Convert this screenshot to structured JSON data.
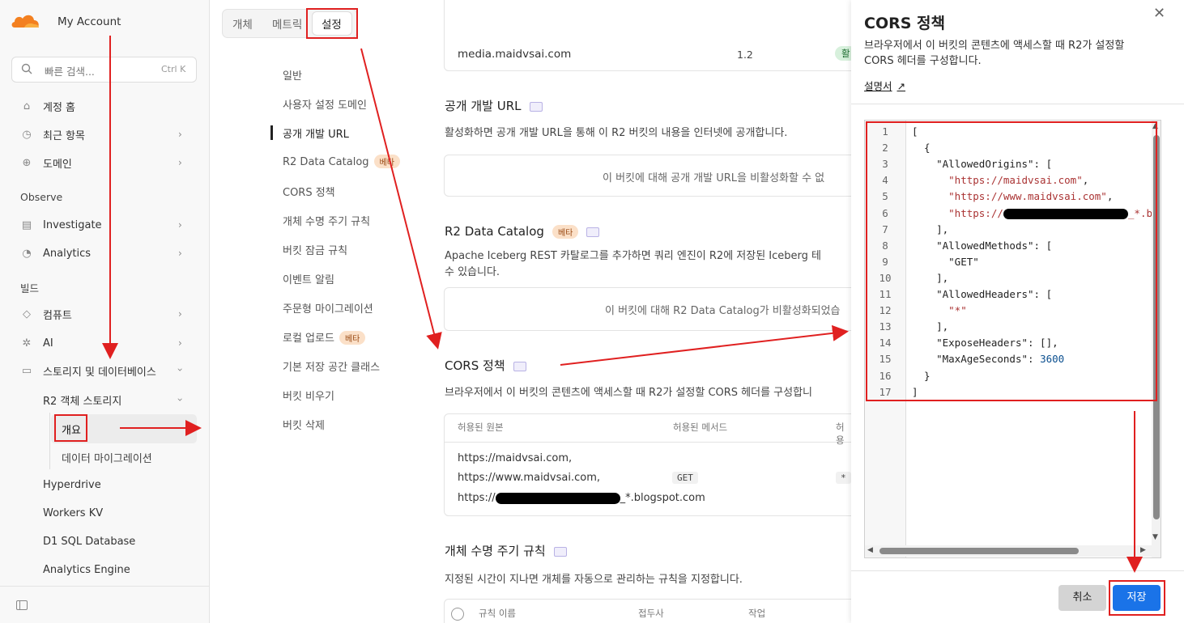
{
  "sidebar": {
    "account": "My Account",
    "search_placeholder": "빠른 검색...",
    "search_shortcut": "Ctrl K",
    "items_top": [
      {
        "label": "계정 홈",
        "icon": "home-icon"
      },
      {
        "label": "최근 항목",
        "icon": "clock-icon"
      },
      {
        "label": "도메인",
        "icon": "globe-icon"
      }
    ],
    "observe_label": "Observe",
    "items_observe": [
      {
        "label": "Investigate",
        "icon": "file-search-icon"
      },
      {
        "label": "Analytics",
        "icon": "chart-icon"
      }
    ],
    "build_label": "빌드",
    "items_build": [
      {
        "label": "컴퓨트",
        "icon": "diamond-icon"
      },
      {
        "label": "AI",
        "icon": "sparkle-icon"
      },
      {
        "label": "스토리지 및 데이터베이스",
        "icon": "database-icon"
      }
    ],
    "r2_label": "R2 객체 스토리지",
    "r2_children": [
      "개요",
      "데이터 마이그레이션"
    ],
    "more_items": [
      "Hyperdrive",
      "Workers KV",
      "D1 SQL Database",
      "Analytics Engine"
    ]
  },
  "tabs": [
    "개체",
    "메트릭",
    "설정"
  ],
  "settings_nav": [
    {
      "label": "일반"
    },
    {
      "label": "사용자 설정 도메인"
    },
    {
      "label": "공개 개발 URL",
      "active": true
    },
    {
      "label": "R2 Data Catalog",
      "badge": "베타"
    },
    {
      "label": "CORS 정책"
    },
    {
      "label": "개체 수명 주기 규칙"
    },
    {
      "label": "버킷 잠금 규칙"
    },
    {
      "label": "이벤트 알림"
    },
    {
      "label": "주문형 마이그레이션"
    },
    {
      "label": "로컬 업로드",
      "badge": "베타"
    },
    {
      "label": "기본 저장 공간 클래스"
    },
    {
      "label": "버킷 비우기"
    },
    {
      "label": "버킷 삭제"
    }
  ],
  "domain_row": {
    "domain": "media.maidvsai.com",
    "version": "1.2",
    "status": "활"
  },
  "public_url": {
    "title": "공개 개발 URL",
    "desc": "활성화하면 공개 개발 URL을 통해 이 R2 버킷의 내용을 인터넷에 공개합니다.",
    "box_text": "이 버킷에 대해 공개 개발 URL을 비활성화할 수 없"
  },
  "catalog": {
    "title": "R2 Data Catalog",
    "badge": "베타",
    "desc1": "Apache Iceberg REST 카탈로그를 추가하면 쿼리 엔진이 R2에 저장된 Iceberg 테",
    "desc2": "수 있습니다.",
    "box_text": "이 버킷에 대해 R2 Data Catalog가 비활성화되었습"
  },
  "cors": {
    "title": "CORS 정책",
    "desc": "브라우저에서 이 버킷의 콘텐츠에 액세스할 때 R2가 설정할 CORS 헤더를 구성합니",
    "col_origins": "허용된 원본",
    "col_methods": "허용된 메서드",
    "col_headers": "허용",
    "origins": [
      "https://maidvsai.com,",
      "https://www.maidvsai.com,",
      "https://",
      "_*.blogspot.com"
    ],
    "method": "GET",
    "header": "*"
  },
  "lifecycle": {
    "title": "개체 수명 주기 규칙",
    "desc": "지정된 시간이 지나면 개체를 자동으로 관리하는 규칙을 지정합니다.",
    "col_name": "규칙 이름",
    "col_prefix": "접두사",
    "col_action": "작업"
  },
  "panel": {
    "title": "CORS 정책",
    "desc": "브라우저에서 이 버킷의 콘텐츠에 액세스할 때 R2가 설정할 CORS 헤더를 구성합니다.",
    "doc_link": "설명서",
    "code_lines": [
      "[",
      "  {",
      "    \"AllowedOrigins\": [",
      "      \"https://maidvsai.com\",",
      "      \"https://www.maidvsai.com\",",
      "      \"https://",
      "    ],",
      "    \"AllowedMethods\": [",
      "      \"GET\"",
      "    ],",
      "    \"AllowedHeaders\": [",
      "      \"*\"",
      "    ],",
      "    \"ExposeHeaders\": [],",
      "    \"MaxAgeSeconds\": 3600",
      "  }",
      "]"
    ],
    "line6_tail": "_*.b",
    "cancel": "취소",
    "save": "저장"
  },
  "colors": {
    "accent": "#1a73e8",
    "highlight": "#e02020",
    "badge": "#fbe0c8"
  }
}
